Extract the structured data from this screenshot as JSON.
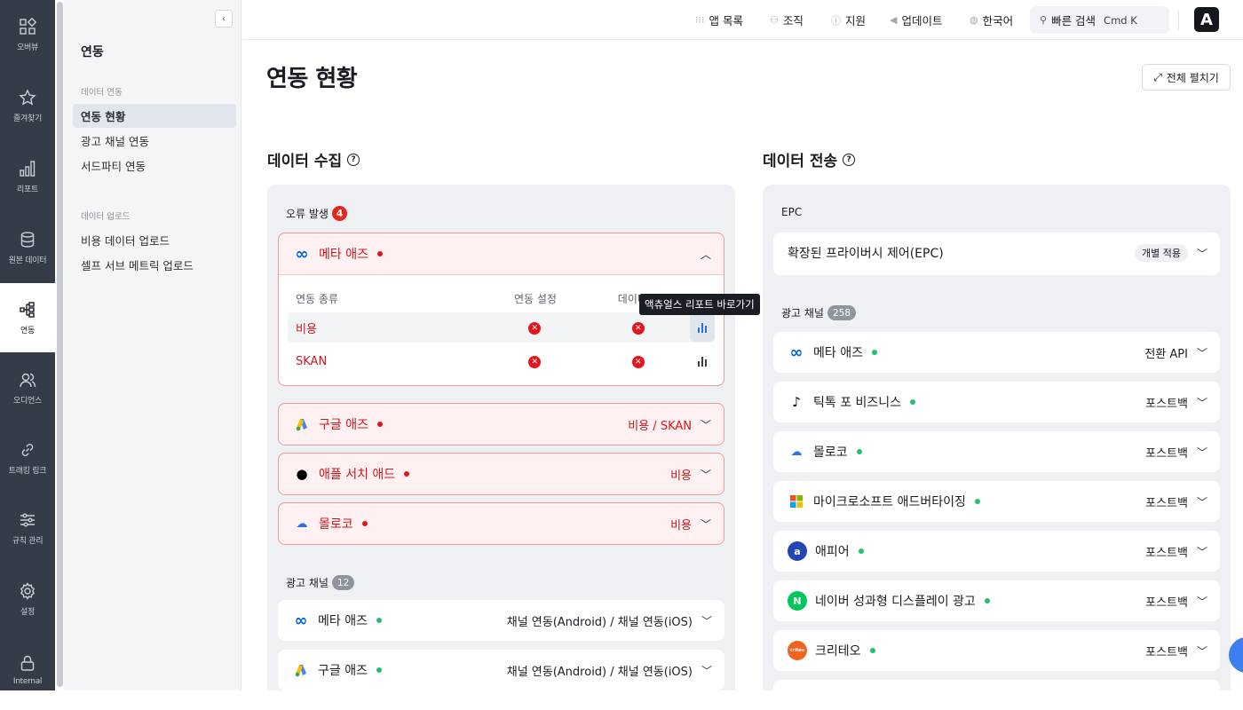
{
  "rail": [
    {
      "label": "오버뷰",
      "icon": "overview-icon"
    },
    {
      "label": "즐겨찾기",
      "icon": "star-icon"
    },
    {
      "label": "리포트",
      "icon": "bar-chart-icon"
    },
    {
      "label": "원본 데이터",
      "icon": "database-icon"
    },
    {
      "label": "연동",
      "icon": "integration-icon"
    },
    {
      "label": "오디언스",
      "icon": "users-icon"
    },
    {
      "label": "트래킹 링크",
      "icon": "link-icon"
    },
    {
      "label": "규칙 관리",
      "icon": "sliders-icon"
    },
    {
      "label": "설정",
      "icon": "gear-icon"
    },
    {
      "label": "Internal",
      "icon": "lock-icon"
    }
  ],
  "subnav": {
    "title": "연동",
    "section1": "데이터 연동",
    "items1": [
      "연동 현황",
      "광고 채널 연동",
      "서드파티 연동"
    ],
    "section2": "데이터 업로드",
    "items2": [
      "비용 데이터 업로드",
      "셀프 서브 메트릭 업로드"
    ]
  },
  "topbar": {
    "apps": "앱 목록",
    "org": "조직",
    "support": "지원",
    "updates": "업데이트",
    "language": "한국어",
    "search": "빠른 검색",
    "shortcut": "Cmd  K",
    "logo": "A"
  },
  "page": {
    "title": "연동 현황",
    "expand_all": "전체 펼치기"
  },
  "collect": {
    "title": "데이터 수집",
    "error_label": "오류 발생",
    "error_count": "4",
    "expanded": {
      "name": "메타 애즈",
      "col_type": "연동 종류",
      "col_setting": "연동 설정",
      "col_data": "데이터 수",
      "rows": [
        "비용",
        "SKAN"
      ],
      "tooltip": "액츄얼스 리포트 바로가기"
    },
    "errors": [
      {
        "name": "구글 애즈",
        "detail": "비용 / SKAN"
      },
      {
        "name": "애플 서치 애드",
        "detail": "비용"
      },
      {
        "name": "몰로코",
        "detail": "비용"
      }
    ],
    "channel_label": "광고 채널",
    "channel_count": "12",
    "channels": [
      {
        "name": "메타 애즈",
        "detail": "채널 연동(Android) / 채널 연동(iOS)"
      },
      {
        "name": "구글 애즈",
        "detail": "채널 연동(Android) / 채널 연동(iOS)"
      }
    ]
  },
  "send": {
    "title": "데이터 전송",
    "epc_label": "EPC",
    "epc_name": "확장된 프라이버시 제어(EPC)",
    "epc_tag": "개별 적용",
    "channel_label": "광고 채널",
    "channel_count": "258",
    "channels": [
      {
        "name": "메타 애즈",
        "detail": "전환 API"
      },
      {
        "name": "틱톡 포 비즈니스",
        "detail": "포스트백"
      },
      {
        "name": "몰로코",
        "detail": "포스트백"
      },
      {
        "name": "마이크로소프트 애드버타이징",
        "detail": "포스트백"
      },
      {
        "name": "애피어",
        "detail": "포스트백"
      },
      {
        "name": "네이버 성과형 디스플레이 광고",
        "detail": "포스트백"
      },
      {
        "name": "크리테오",
        "detail": "포스트백"
      }
    ]
  },
  "colors": {
    "rail": "#353c47",
    "error": "#d4141b",
    "ok": "#1fc16b"
  }
}
